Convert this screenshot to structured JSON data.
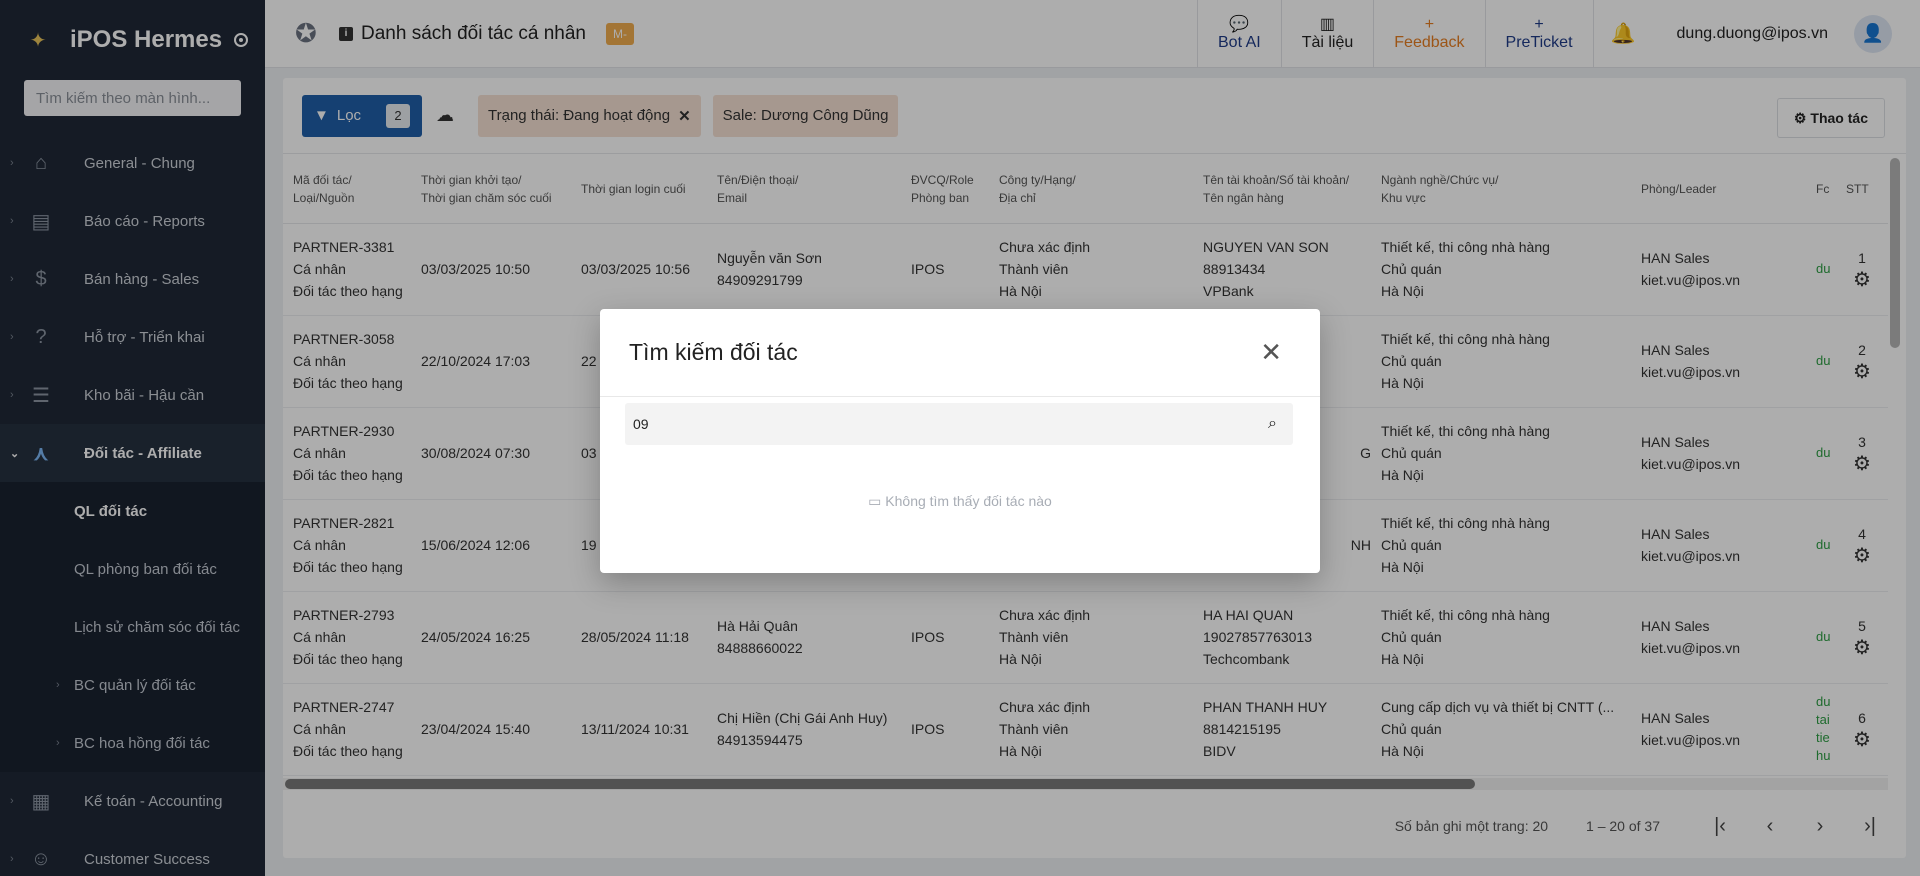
{
  "app": {
    "title": "iPOS Hermes",
    "search_placeholder": "Tìm kiếm theo màn hình..."
  },
  "sidebar": {
    "items": [
      {
        "label": "General - Chung"
      },
      {
        "label": "Báo cáo - Reports"
      },
      {
        "label": "Bán hàng - Sales"
      },
      {
        "label": "Hỗ trợ - Triển khai"
      },
      {
        "label": "Kho bãi - Hậu cần"
      },
      {
        "label": "Đối tác - Affiliate"
      },
      {
        "label": "Kế toán - Accounting"
      },
      {
        "label": "Customer Success"
      }
    ],
    "sub_items": [
      {
        "label": "QL đối tác"
      },
      {
        "label": "QL phòng ban đối tác"
      },
      {
        "label": "Lịch sử chăm sóc đối tác"
      },
      {
        "label": "BC quản lý đối tác"
      },
      {
        "label": "BC hoa hồng đối tác"
      }
    ]
  },
  "header": {
    "title": "Danh sách đối tác cá nhân",
    "badge": "M-",
    "buttons": {
      "bot_ai": "Bot AI",
      "docs": "Tài liệu",
      "feedback": "Feedback",
      "preticket": "PreTicket"
    },
    "plus": "+",
    "user_email": "dung.duong@ipos.vn"
  },
  "filters": {
    "filter_label": "Lọc",
    "filter_count": "2",
    "chips": [
      "Trạng thái: Đang hoạt động",
      "Sale: Dương Công Dũng"
    ],
    "actions_label": "Thao tác"
  },
  "table": {
    "headers": [
      [
        "Mã đối tác/",
        "Loại/Nguồn"
      ],
      [
        "Thời gian khởi tạo/",
        "Thời gian chăm sóc cuối"
      ],
      [
        "Thời gian login cuối",
        ""
      ],
      [
        "Tên/Điện thoại/",
        "Email"
      ],
      [
        "ĐVCQ/Role",
        "Phòng ban"
      ],
      [
        "Công ty/Hạng/",
        "Địa chỉ"
      ],
      [
        "Tên tài khoản/Số tài khoản/",
        "Tên ngân hàng"
      ],
      [
        "Ngành nghề/Chức vụ/",
        "Khu vực"
      ],
      [
        "Phòng/Leader",
        ""
      ],
      [
        "Fc",
        ""
      ],
      [
        "STT",
        ""
      ]
    ],
    "rows": [
      {
        "code": [
          "PARTNER-3381",
          "Cá nhân",
          "Đối tác theo hạng"
        ],
        "created": "03/03/2025 10:50",
        "login": "03/03/2025 10:56",
        "name": [
          "Nguyễn văn Sơn",
          "84909291799"
        ],
        "role": "IPOS",
        "company": [
          "Chưa xác định",
          "Thành viên",
          "Hà Nội"
        ],
        "bank": [
          "NGUYEN VAN SON",
          "88913434",
          "VPBank"
        ],
        "job": [
          "Thiết kế, thi công nhà hàng",
          "Chủ quán",
          "Hà Nội"
        ],
        "dept": [
          "HAN Sales",
          "kiet.vu@ipos.vn"
        ],
        "fc": [
          "du"
        ],
        "stt": "1"
      },
      {
        "code": [
          "PARTNER-3058",
          "Cá nhân",
          "Đối tác theo hạng"
        ],
        "created": "22/10/2024 17:03",
        "login": "22",
        "name": [
          "",
          ""
        ],
        "role": "",
        "company": [
          "",
          "",
          ""
        ],
        "bank": [
          "",
          "",
          ""
        ],
        "job": [
          "Thiết kế, thi công nhà hàng",
          "Chủ quán",
          "Hà Nội"
        ],
        "dept": [
          "HAN Sales",
          "kiet.vu@ipos.vn"
        ],
        "fc": [
          "du"
        ],
        "stt": "2"
      },
      {
        "code": [
          "PARTNER-2930",
          "Cá nhân",
          "Đối tác theo hạng"
        ],
        "created": "30/08/2024 07:30",
        "login": "03",
        "name": [
          "",
          ""
        ],
        "role": "",
        "company": [
          "",
          "",
          ""
        ],
        "bank": [
          "G",
          "",
          ""
        ],
        "job": [
          "Thiết kế, thi công nhà hàng",
          "Chủ quán",
          "Hà Nội"
        ],
        "dept": [
          "HAN Sales",
          "kiet.vu@ipos.vn"
        ],
        "fc": [
          "du"
        ],
        "stt": "3"
      },
      {
        "code": [
          "PARTNER-2821",
          "Cá nhân",
          "Đối tác theo hạng"
        ],
        "created": "15/06/2024 12:06",
        "login": "19",
        "name": [
          "",
          ""
        ],
        "role": "",
        "company": [
          "",
          "",
          ""
        ],
        "bank": [
          "NH",
          "",
          ""
        ],
        "job": [
          "Thiết kế, thi công nhà hàng",
          "Chủ quán",
          "Hà Nội"
        ],
        "dept": [
          "HAN Sales",
          "kiet.vu@ipos.vn"
        ],
        "fc": [
          "du"
        ],
        "stt": "4"
      },
      {
        "code": [
          "PARTNER-2793",
          "Cá nhân",
          "Đối tác theo hạng"
        ],
        "created": "24/05/2024 16:25",
        "login": "28/05/2024 11:18",
        "name": [
          "Hà Hải Quân",
          "84888660022"
        ],
        "role": "IPOS",
        "company": [
          "Chưa xác định",
          "Thành viên",
          "Hà Nội"
        ],
        "bank": [
          "HA HAI QUAN",
          "19027857763013",
          "Techcombank"
        ],
        "job": [
          "Thiết kế, thi công nhà hàng",
          "Chủ quán",
          "Hà Nội"
        ],
        "dept": [
          "HAN Sales",
          "kiet.vu@ipos.vn"
        ],
        "fc": [
          "du"
        ],
        "stt": "5"
      },
      {
        "code": [
          "PARTNER-2747",
          "Cá nhân",
          "Đối tác theo hạng"
        ],
        "created": "23/04/2024 15:40",
        "login": "13/11/2024 10:31",
        "name": [
          "Chị Hiền (Chị Gái Anh Huy)",
          "84913594475"
        ],
        "role": "IPOS",
        "company": [
          "Chưa xác định",
          "Thành viên",
          "Hà Nội"
        ],
        "bank": [
          "PHAN THANH HUY",
          "8814215195",
          "BIDV"
        ],
        "job": [
          "Cung cấp dịch vụ và thiết bị CNTT (...",
          "Chủ quán",
          "Hà Nội"
        ],
        "dept": [
          "HAN Sales",
          "kiet.vu@ipos.vn"
        ],
        "fc": [
          "du",
          "tai",
          "tie",
          "hu"
        ],
        "stt": "6"
      }
    ]
  },
  "pager": {
    "per_page": "Số bản ghi một trang: 20",
    "range": "1 – 20 of 37"
  },
  "modal": {
    "title": "Tìm kiếm đối tác",
    "search_value": "09",
    "empty_text": "Không tìm thấy đối tác nào"
  },
  "colors": {
    "sidebar_bg": "#1f2937",
    "primary": "#1f5fa8",
    "chip_bg": "#f5e1d3",
    "feedback": "#e67e22",
    "badge": "#f0ad4e"
  }
}
